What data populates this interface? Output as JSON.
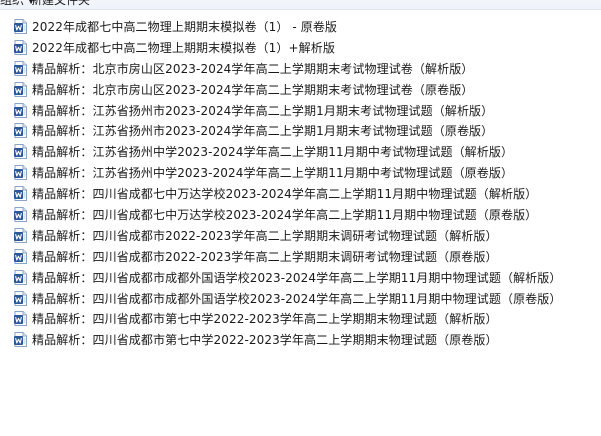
{
  "toolbar": {
    "organize_label": "组织 ▾",
    "new_folder_label": "新建文件夹"
  },
  "icons": {
    "file_type_icon": "word-document-icon",
    "icon_color": "#2b579a"
  },
  "files": [
    {
      "name": "2022年成都七中高二物理上期期末模拟卷（1） - 原卷版"
    },
    {
      "name": "2022年成都七中高二物理上期期末模拟卷（1）+解析版"
    },
    {
      "name": "精品解析：北京市房山区2023-2024学年高二上学期期末考试物理试卷（解析版）"
    },
    {
      "name": "精品解析：北京市房山区2023-2024学年高二上学期期末考试物理试卷（原卷版）"
    },
    {
      "name": "精品解析：江苏省扬州市2023-2024学年高二上学期1月期末考试物理试题（解析版）"
    },
    {
      "name": "精品解析：江苏省扬州市2023-2024学年高二上学期1月期末考试物理试题（原卷版）"
    },
    {
      "name": "精品解析：江苏省扬州中学2023-2024学年高二上学期11月期中考试物理试题（解析版）"
    },
    {
      "name": "精品解析：江苏省扬州中学2023-2024学年高二上学期11月期中考试物理试题（原卷版）"
    },
    {
      "name": "精品解析：四川省成都七中万达学校2023-2024学年高二上学期11月期中物理试题（解析版）"
    },
    {
      "name": "精品解析：四川省成都七中万达学校2023-2024学年高二上学期11月期中物理试题（原卷版）"
    },
    {
      "name": "精品解析：四川省成都市2022-2023学年高二上学期期末调研考试物理试题（解析版）"
    },
    {
      "name": "精品解析：四川省成都市2022-2023学年高二上学期期末调研考试物理试题（原卷版）"
    },
    {
      "name": "精品解析：四川省成都市成都外国语学校2023-2024学年高二上学期11月期中物理试题（解析版）"
    },
    {
      "name": "精品解析：四川省成都市成都外国语学校2023-2024学年高二上学期11月期中物理试题（原卷版）"
    },
    {
      "name": "精品解析：四川省成都市第七中学2022-2023学年高二上学期期末物理试题（解析版）"
    },
    {
      "name": "精品解析：四川省成都市第七中学2022-2023学年高二上学期期末物理试题（原卷版）"
    }
  ]
}
